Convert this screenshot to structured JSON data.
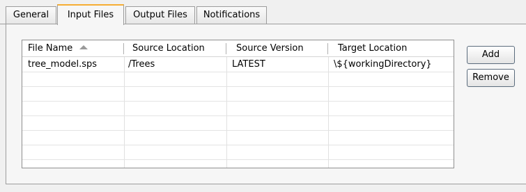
{
  "tabs": [
    {
      "label": "General"
    },
    {
      "label": "Input Files"
    },
    {
      "label": "Output Files"
    },
    {
      "label": "Notifications"
    }
  ],
  "table": {
    "columns": [
      "File Name",
      "Source Location",
      "Source Version",
      "Target Location"
    ],
    "sort_column": "File Name",
    "rows": [
      [
        "tree_model.sps",
        "/Trees",
        "LATEST",
        "\\${workingDirectory}"
      ]
    ]
  },
  "buttons": {
    "add": "Add",
    "remove": "Remove"
  },
  "colors": {
    "active_tab_accent": "#f6ad33",
    "panel_bg": "#f6f6f6",
    "window_bg": "#f0f0f0"
  }
}
